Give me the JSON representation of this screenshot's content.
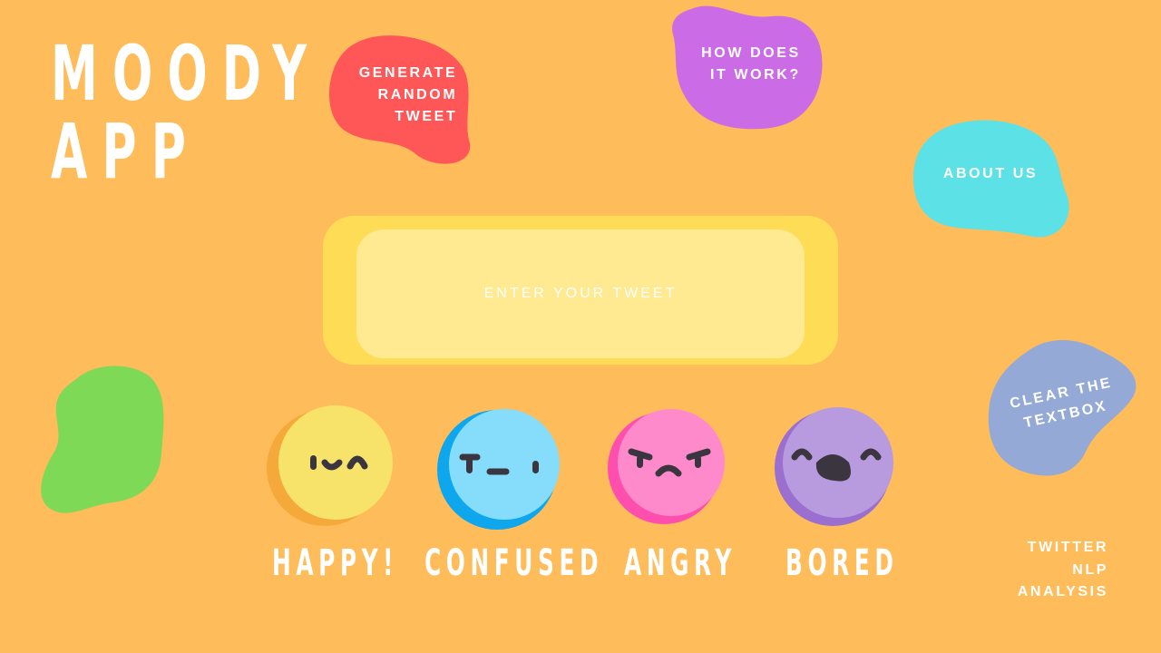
{
  "app": {
    "title_line1": "MOODY",
    "title_line2": "APP"
  },
  "nav": {
    "generate_label": "GENERATE\nRANDOM\nTWEET",
    "how_label": "HOW DOES\nIT WORK?",
    "about_label": "ABOUT US",
    "clear_label": "CLEAR THE\nTEXTBOX"
  },
  "tweet": {
    "placeholder": "ENTER YOUR TWEET",
    "value": ""
  },
  "moods": [
    {
      "label": "HAPPY!",
      "icon": "happy-face-icon",
      "color": "#F7E36A"
    },
    {
      "label": "CONFUSED",
      "icon": "confused-face-icon",
      "color": "#85DDFB"
    },
    {
      "label": "ANGRY",
      "icon": "angry-face-icon",
      "color": "#FF8ACB"
    },
    {
      "label": "BORED",
      "icon": "bored-face-icon",
      "color": "#B89ADF"
    }
  ],
  "footer": {
    "line1": "TWITTER",
    "line2": "NLP",
    "line3": "ANALYSIS"
  },
  "colors": {
    "background": "#FFBC5A",
    "generate_blob": "#FF5757",
    "how_blob": "#CB6CE6",
    "about_blob": "#5CE1E6",
    "clear_blob": "#94A9D6",
    "decor_blob": "#7ED957"
  }
}
